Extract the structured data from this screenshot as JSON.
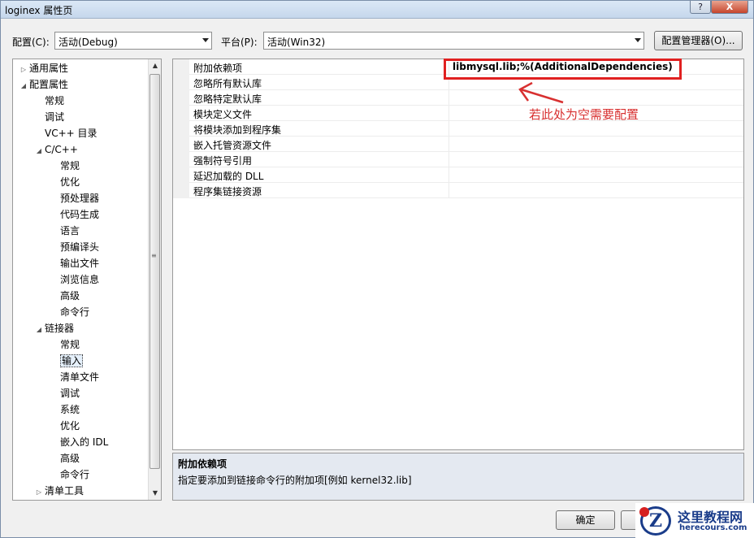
{
  "window": {
    "title": "loginex 属性页",
    "help_label": "?",
    "close_label": "X"
  },
  "toolbar": {
    "config_label": "配置(C):",
    "config_value": "活动(Debug)",
    "platform_label": "平台(P):",
    "platform_value": "活动(Win32)",
    "config_manager_label": "配置管理器(O)..."
  },
  "tree": {
    "items": [
      {
        "label": "通用属性",
        "expander": "▷"
      },
      {
        "label": "配置属性",
        "expander": "◢"
      },
      {
        "label": "常规",
        "expander": ""
      },
      {
        "label": "调试",
        "expander": ""
      },
      {
        "label": "VC++ 目录",
        "expander": ""
      },
      {
        "label": "C/C++",
        "expander": "◢"
      },
      {
        "label": "常规",
        "expander": ""
      },
      {
        "label": "优化",
        "expander": ""
      },
      {
        "label": "预处理器",
        "expander": ""
      },
      {
        "label": "代码生成",
        "expander": ""
      },
      {
        "label": "语言",
        "expander": ""
      },
      {
        "label": "预编译头",
        "expander": ""
      },
      {
        "label": "输出文件",
        "expander": ""
      },
      {
        "label": "浏览信息",
        "expander": ""
      },
      {
        "label": "高级",
        "expander": ""
      },
      {
        "label": "命令行",
        "expander": ""
      },
      {
        "label": "链接器",
        "expander": "◢"
      },
      {
        "label": "常规",
        "expander": ""
      },
      {
        "label": "输入",
        "expander": ""
      },
      {
        "label": "清单文件",
        "expander": ""
      },
      {
        "label": "调试",
        "expander": ""
      },
      {
        "label": "系统",
        "expander": ""
      },
      {
        "label": "优化",
        "expander": ""
      },
      {
        "label": "嵌入的 IDL",
        "expander": ""
      },
      {
        "label": "高级",
        "expander": ""
      },
      {
        "label": "命令行",
        "expander": ""
      },
      {
        "label": "清单工具",
        "expander": "▷"
      }
    ],
    "selected": "输入"
  },
  "properties": {
    "rows": [
      {
        "name": "附加依赖项",
        "value": "libmysql.lib;%(AdditionalDependencies)"
      },
      {
        "name": "忽略所有默认库",
        "value": ""
      },
      {
        "name": "忽略特定默认库",
        "value": ""
      },
      {
        "name": "模块定义文件",
        "value": ""
      },
      {
        "name": "将模块添加到程序集",
        "value": ""
      },
      {
        "name": "嵌入托管资源文件",
        "value": ""
      },
      {
        "name": "强制符号引用",
        "value": ""
      },
      {
        "name": "延迟加载的 DLL",
        "value": ""
      },
      {
        "name": "程序集链接资源",
        "value": ""
      }
    ]
  },
  "annotation": {
    "text": "若此处为空需要配置",
    "color": "#d83030"
  },
  "description": {
    "title": "附加依赖项",
    "text": "指定要添加到链接命令行的附加项[例如 kernel32.lib]"
  },
  "footer": {
    "ok_label": "确定"
  },
  "watermark": {
    "mark": "Z",
    "name": "这里教程网",
    "site": "herecours.com"
  }
}
